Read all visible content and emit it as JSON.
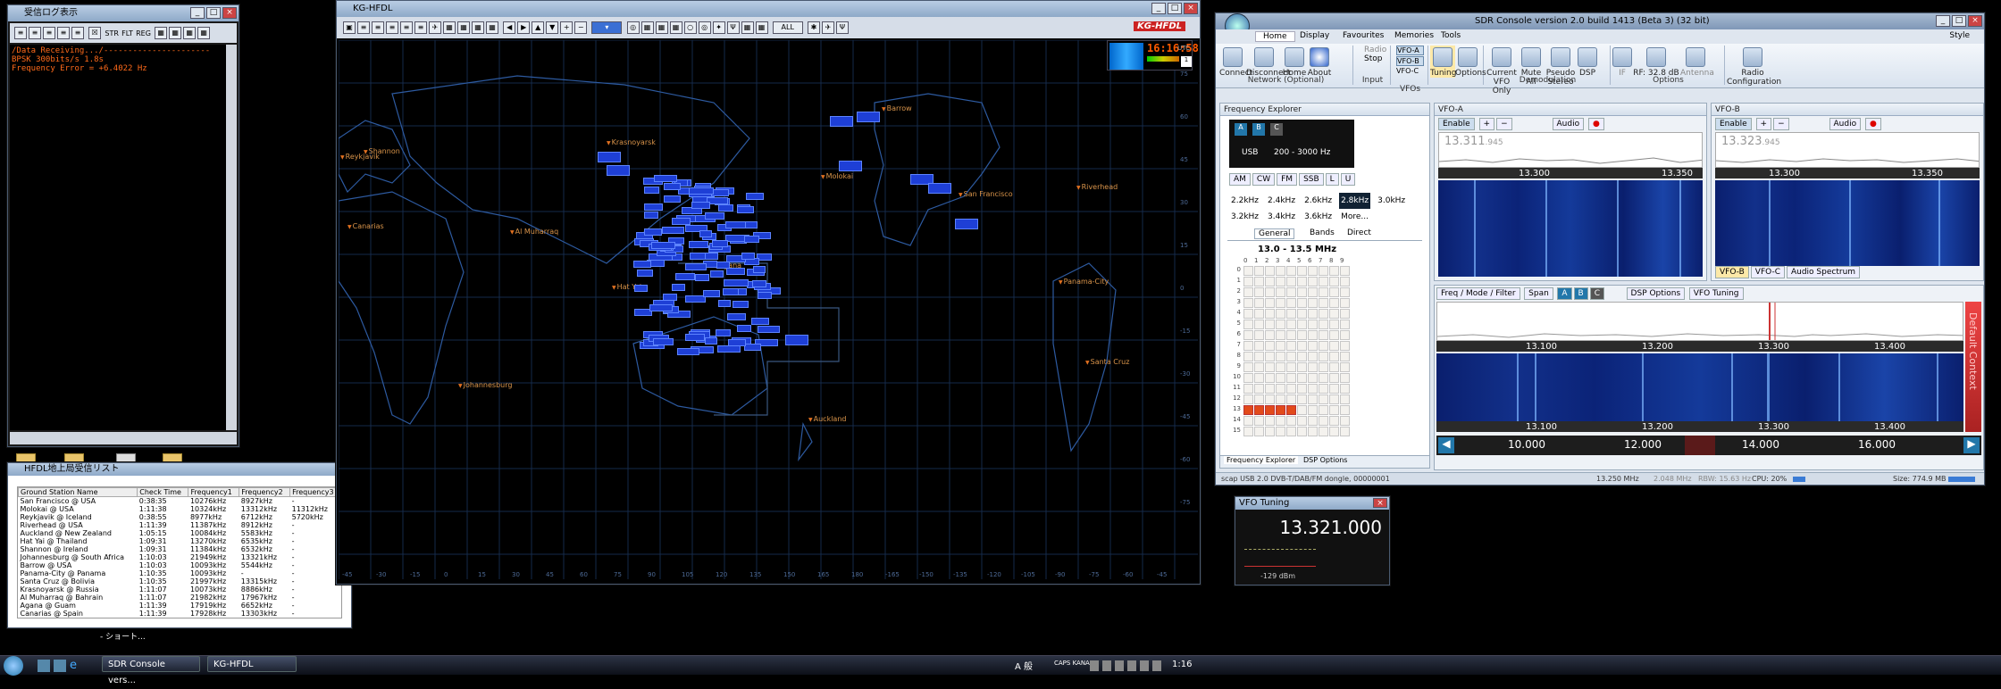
{
  "desktop": {
    "background": "#000000"
  },
  "log_window": {
    "title": "受信ログ表示",
    "toolbar": [
      "STR",
      "FLT",
      "REG"
    ],
    "lines": [
      "/Data Receiving.../----------------------",
      "BPSK 300bits/s 1.8s",
      "Frequency Error = +6.4022 Hz"
    ],
    "text_color": "#ff6a1a"
  },
  "station_list": {
    "title": "HFDL地上局受信リスト",
    "columns": [
      "Ground Station Name",
      "Check Time",
      "Frequency1",
      "Frequency2",
      "Frequency3"
    ],
    "rows": [
      [
        "San Francisco @ USA",
        "0:38:35",
        "10276kHz",
        "8927kHz",
        "-"
      ],
      [
        "Molokai @ USA",
        "1:11:38",
        "10324kHz",
        "13312kHz",
        "11312kHz"
      ],
      [
        "Reykjavik @ Iceland",
        "0:38:55",
        "8977kHz",
        "6712kHz",
        "5720kHz"
      ],
      [
        "Riverhead @ USA",
        "1:11:39",
        "11387kHz",
        "8912kHz",
        "-"
      ],
      [
        "Auckland @ New Zealand",
        "1:05:15",
        "10084kHz",
        "5583kHz",
        "-"
      ],
      [
        "Hat Yai @ Thailand",
        "1:09:31",
        "13270kHz",
        "6535kHz",
        "-"
      ],
      [
        "Shannon @ Ireland",
        "1:09:31",
        "11384kHz",
        "6532kHz",
        "-"
      ],
      [
        "Johannesburg @ South Africa",
        "1:10:03",
        "21949kHz",
        "13321kHz",
        "-"
      ],
      [
        "Barrow @ USA",
        "1:10:03",
        "10093kHz",
        "5544kHz",
        "-"
      ],
      [
        "Panama-City @ Panama",
        "1:10:35",
        "10093kHz",
        "-",
        "-"
      ],
      [
        "Santa Cruz @ Bolivia",
        "1:10:35",
        "21997kHz",
        "13315kHz",
        "-"
      ],
      [
        "Krasnoyarsk @ Russia",
        "1:11:07",
        "10073kHz",
        "8886kHz",
        "-"
      ],
      [
        "Al Muharraq @ Bahrain",
        "1:11:07",
        "21982kHz",
        "17967kHz",
        "-"
      ],
      [
        "Agana @ Guam",
        "1:11:39",
        "17919kHz",
        "6652kHz",
        "-"
      ],
      [
        "Canarias @ Spain",
        "1:11:39",
        "17928kHz",
        "13303kHz",
        "-"
      ]
    ],
    "footer": "- ショート..."
  },
  "map_window": {
    "title": "KG-HFDL",
    "logo": "KG-HFDL",
    "utc_time": "16:16:58",
    "utc_label": "UTC",
    "mode_select": "ALL",
    "ch_select": "1",
    "cities": [
      "Barrow",
      "Reykjavik",
      "Krasnoyarsk",
      "Shannon",
      "San Francisco",
      "Riverhead",
      "Canarias",
      "Al Muharraq",
      "Molokai",
      "Hat Yai",
      "Panama-City",
      "Agana",
      "Santa Cruz",
      "Johannesburg",
      "Auckland"
    ],
    "lat_ticks": [
      "75",
      "60",
      "45",
      "30",
      "15",
      "0",
      "-15",
      "-30",
      "-45",
      "-60",
      "-75"
    ],
    "lon_ticks": [
      "-45",
      "-30",
      "-15",
      "0",
      "15",
      "30",
      "45",
      "60",
      "75",
      "90",
      "105",
      "120",
      "135",
      "150",
      "165",
      "180",
      "-165",
      "-150",
      "-135",
      "-120",
      "-105",
      "-90",
      "-75",
      "-60",
      "-45"
    ]
  },
  "sdr": {
    "title": "SDR Console version 2.0 build 1413 (Beta 3) (32 bit)",
    "style_label": "Style",
    "tabs": [
      "Home",
      "Display",
      "Favourites",
      "Memories",
      "Tools"
    ],
    "ribbon": {
      "network": [
        "Connect",
        "Disconnect",
        "Home",
        "About"
      ],
      "network_label": "Network (Optional)",
      "input": [
        "Radio",
        "Stop"
      ],
      "input_label": "Input",
      "vfos": [
        "VFO-A",
        "VFO-B",
        "VFO-C"
      ],
      "vfos_label": "VFOs",
      "tuning": [
        "Tuning",
        "Options"
      ],
      "demod": [
        "Current VFO Only",
        "Mute All",
        "Pseudo Stereo",
        "DSP"
      ],
      "demod_label": "Demodulation",
      "options": [
        "IF",
        "RF: 32.8 dB",
        "Antenna"
      ],
      "options_label": "Options",
      "config": "Radio Configuration"
    },
    "freq_explorer": {
      "title": "Frequency Explorer",
      "mode": "USB",
      "bandwidth": "200 - 3000 Hz",
      "modes": [
        "AM",
        "CW",
        "FM",
        "SSB",
        "L",
        "U"
      ],
      "filters": [
        "2.2kHz",
        "2.4kHz",
        "2.6kHz",
        "2.8kHz",
        "3.0kHz",
        "3.2kHz",
        "3.4kHz",
        "3.6kHz",
        "More..."
      ],
      "selected_filter": "2.8kHz",
      "tabs": [
        "General",
        "Bands",
        "Direct"
      ],
      "range": "13.0 - 13.5 MHz",
      "cols": [
        "0",
        "1",
        "2",
        "3",
        "4",
        "5",
        "6",
        "7",
        "8",
        "9"
      ],
      "rows": [
        "0",
        "1",
        "2",
        "3",
        "4",
        "5",
        "6",
        "7",
        "8",
        "9",
        "10",
        "11",
        "12",
        "13",
        "14",
        "15"
      ],
      "bottom_tabs": [
        "Frequency Explorer",
        "DSP Options"
      ]
    },
    "vfo_a": {
      "title": "VFO-A",
      "enable": "Enable",
      "audio": "Audio",
      "freq": "13.311",
      "freq_small": ".945",
      "ticks": [
        "13.300",
        "13.350"
      ]
    },
    "vfo_b": {
      "title": "VFO-B",
      "enable": "Enable",
      "audio": "Audio",
      "freq": "13.323",
      "freq_small": ".945",
      "ticks": [
        "13.300",
        "13.350"
      ],
      "tabs": [
        "VFO-B",
        "VFO-C",
        "Audio Spectrum"
      ]
    },
    "main": {
      "toolbar": [
        "Freq / Mode / Filter",
        "Span",
        "DSP Options",
        "VFO Tuning"
      ],
      "spectrum_ticks": [
        "13.100",
        "13.200",
        "13.300",
        "13.400"
      ],
      "wf_ticks": [
        "13.100",
        "13.200",
        "13.300",
        "13.400"
      ],
      "scale": [
        "10.000",
        "12.000",
        "14.000",
        "16.000"
      ],
      "side_label": "Default Context"
    },
    "status": [
      "scap USB 2.0 DVB-T/DAB/FM dongle, 00000001",
      "13.250 MHz",
      "2.048 MHz",
      "RBW: 15.63 Hz",
      "CPU: 20%",
      "Size: 774.9 MB"
    ]
  },
  "vfo_tuning": {
    "title": "VFO Tuning",
    "freq": "13.321.000",
    "level": "-129 dBm"
  },
  "taskbar": {
    "items": [
      "SDR Console vers...",
      "KG-HFDL"
    ],
    "tray": [
      "A 般",
      "CAPS KANA",
      "1:16"
    ]
  }
}
